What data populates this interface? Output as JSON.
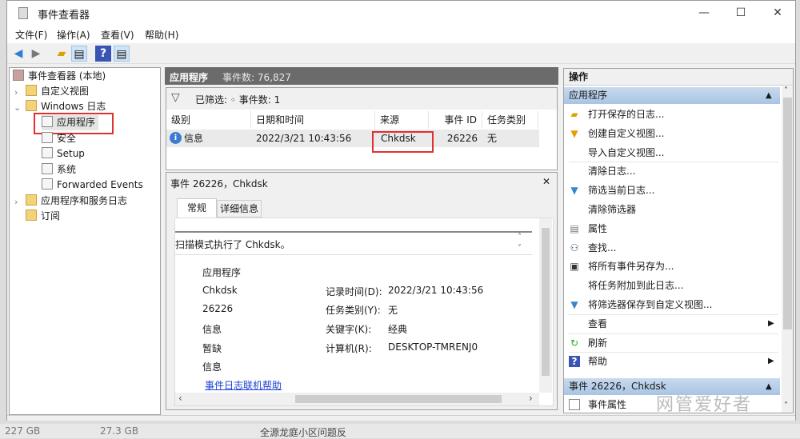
{
  "window": {
    "title": "事件查看器",
    "min": "—",
    "max": "☐",
    "close": "✕"
  },
  "menu": [
    "文件(F)",
    "操作(A)",
    "查看(V)",
    "帮助(H)"
  ],
  "tree": {
    "root": "事件查看器 (本地)",
    "custom_views": "自定义视图",
    "windows_logs": "Windows 日志",
    "logs": [
      "应用程序",
      "安全",
      "Setup",
      "系统",
      "Forwarded Events"
    ],
    "app_service_logs": "应用程序和服务日志",
    "subscriptions": "订阅"
  },
  "center": {
    "log_name": "应用程序",
    "event_count": "事件数: 76,827",
    "filter_text": "已筛选: ◦ 事件数: 1",
    "columns": [
      "级别",
      "日期和时间",
      "来源",
      "事件 ID",
      "任务类别"
    ],
    "rows": [
      {
        "level": "信息",
        "datetime": "2022/3/21 10:43:56",
        "source": "Chkdsk",
        "event_id": "26226",
        "task": "无"
      }
    ]
  },
  "detail": {
    "title": "事件 26226，Chkdsk",
    "close": "✕",
    "tabs": [
      "常规",
      "详细信息"
    ],
    "description": "扫描模式执行了 Chkdsk。",
    "left_values": [
      "应用程序",
      "Chkdsk",
      "26226",
      "信息",
      "暂缺",
      "信息"
    ],
    "fields": [
      {
        "label": "记录时间(D):",
        "value": "2022/3/21 10:43:56"
      },
      {
        "label": "任务类别(Y):",
        "value": "无"
      },
      {
        "label": "关键字(K):",
        "value": "经典"
      },
      {
        "label": "计算机(R):",
        "value": "DESKTOP-TMRENJ0"
      }
    ],
    "help_link": "事件日志联机帮助"
  },
  "actions": {
    "header": "操作",
    "section1": "应用程序",
    "items": [
      "打开保存的日志...",
      "创建自定义视图...",
      "导入自定义视图...",
      "清除日志...",
      "筛选当前日志...",
      "清除筛选器",
      "属性",
      "查找...",
      "将所有事件另存为...",
      "将任务附加到此日志...",
      "将筛选器保存到自定义视图...",
      "查看",
      "刷新",
      "帮助"
    ],
    "section2": "事件 26226，Chkdsk",
    "section2_items": [
      "事件属性"
    ]
  },
  "watermark": "网管爱好者",
  "background": {
    "texts": [
      "227 GB",
      "27.3 GB",
      "全源龙庭小区问题反"
    ]
  }
}
